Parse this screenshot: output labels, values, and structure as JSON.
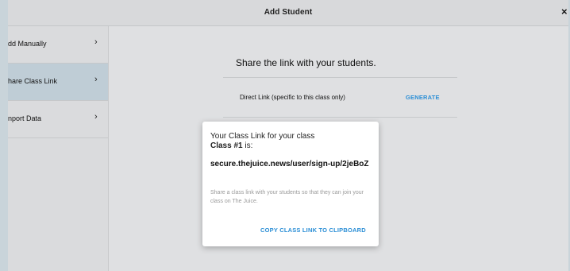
{
  "header": {
    "title": "Add Student",
    "close_symbol": "×"
  },
  "sidebar": {
    "items": [
      {
        "label": "dd Manually",
        "chevron": "›",
        "active": false
      },
      {
        "label": "hare Class Link",
        "chevron": "›",
        "active": true
      },
      {
        "label": "nport Data",
        "chevron": "›",
        "active": false
      }
    ]
  },
  "main": {
    "title": "Share the link with your students.",
    "direct_link_label": "Direct Link (specific to this class only)",
    "generate_label": "GENERATE"
  },
  "popup": {
    "line1": "Your Class Link for your class",
    "class_name": "Class #1",
    "line2_suffix": " is:",
    "link": "secure.thejuice.news/user/sign-up/2jeBoZ",
    "description": "Share a class link with your students so that they can join your class on The Juice.",
    "copy_label": "COPY CLASS LINK TO CLIPBOARD"
  },
  "colors": {
    "accent": "#2c8fd6",
    "active_item": "#bfcdd6",
    "background": "#dfe0e2"
  }
}
